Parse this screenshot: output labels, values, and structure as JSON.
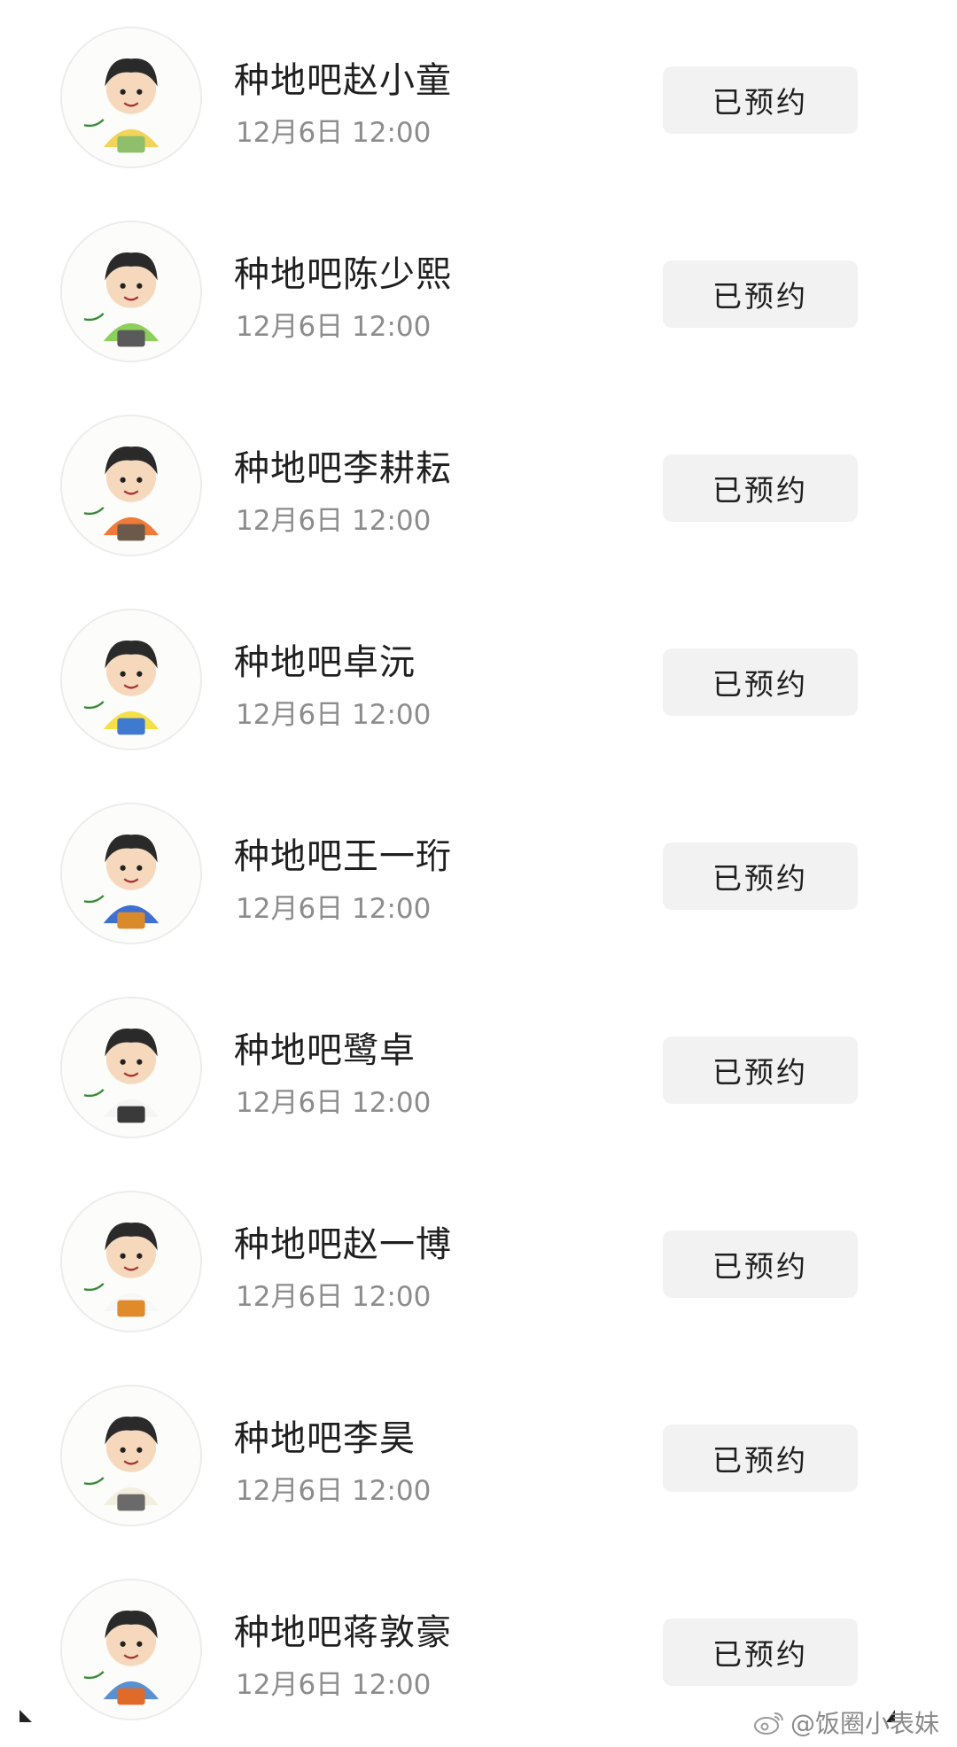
{
  "items": [
    {
      "name": "种地吧赵小童",
      "time": "12月6日 12:00",
      "button": "已预约",
      "shirt": "#f3d45a",
      "pants": "#8fbf6a",
      "hair": "#2a2a2a"
    },
    {
      "name": "种地吧陈少熙",
      "time": "12月6日 12:00",
      "button": "已预约",
      "shirt": "#8ccf5a",
      "pants": "#5a5a5a",
      "hair": "#2a2a2a"
    },
    {
      "name": "种地吧李耕耘",
      "time": "12月6日 12:00",
      "button": "已预约",
      "shirt": "#f07a3a",
      "pants": "#6b5a4a",
      "hair": "#2a2a2a"
    },
    {
      "name": "种地吧卓沅",
      "time": "12月6日 12:00",
      "button": "已预约",
      "shirt": "#f5e04a",
      "pants": "#3f7ad0",
      "hair": "#2a2a2a"
    },
    {
      "name": "种地吧王一珩",
      "time": "12月6日 12:00",
      "button": "已预约",
      "shirt": "#3f6fd0",
      "pants": "#d98a2a",
      "hair": "#2a2a2a"
    },
    {
      "name": "种地吧鹭卓",
      "time": "12月6日 12:00",
      "button": "已预约",
      "shirt": "#f5f5f5",
      "pants": "#3a3a3a",
      "hair": "#2a2a2a"
    },
    {
      "name": "种地吧赵一博",
      "time": "12月6日 12:00",
      "button": "已预约",
      "shirt": "#f7f7f7",
      "pants": "#e08a2a",
      "hair": "#2a2a2a"
    },
    {
      "name": "种地吧李昊",
      "time": "12月6日 12:00",
      "button": "已预约",
      "shirt": "#f2efe0",
      "pants": "#6a6a6a",
      "hair": "#2a2a2a"
    },
    {
      "name": "种地吧蒋敦豪",
      "time": "12月6日 12:00",
      "button": "已预约",
      "shirt": "#5a8fd0",
      "pants": "#e06a2a",
      "hair": "#2a2a2a"
    }
  ],
  "watermark": {
    "text": "@饭圈小表妹",
    "icon": "weibo-icon"
  },
  "colors": {
    "button_bg": "#f2f2f2",
    "name_text": "#1f1f1f",
    "time_text": "#8c8c8c"
  }
}
